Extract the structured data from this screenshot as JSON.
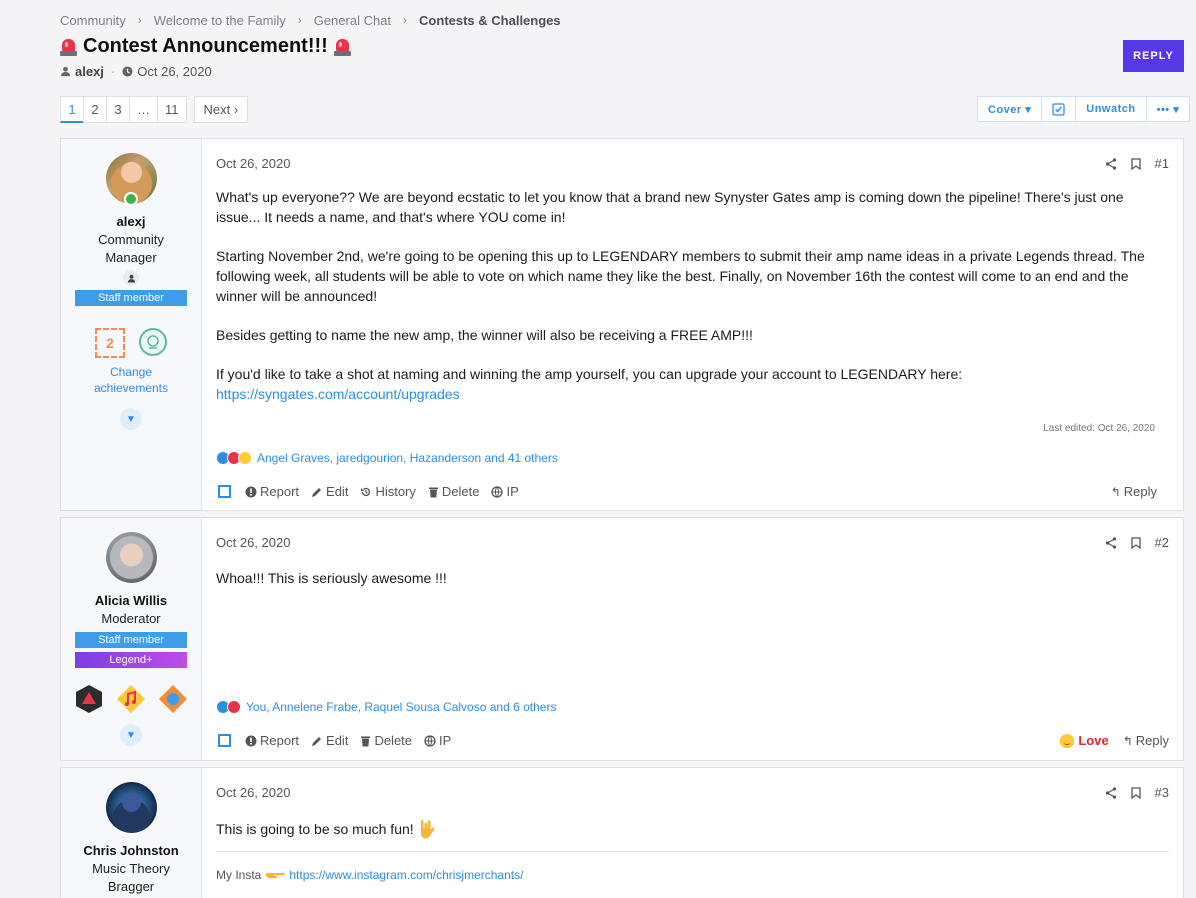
{
  "breadcrumb": [
    "Community",
    "Welcome to the Family",
    "General Chat",
    "Contests & Challenges"
  ],
  "thread": {
    "title": "Contest Announcement!!!",
    "author": "alexj",
    "date": "Oct 26, 2020",
    "reply_label": "REPLY"
  },
  "pager": {
    "pages": [
      "1",
      "2",
      "3",
      "…",
      "11"
    ],
    "next": "Next ›",
    "active": "1"
  },
  "top_actions": {
    "cover": "Cover ▾",
    "unwatch": "Unwatch",
    "more": "••• ▾"
  },
  "posts": [
    {
      "user": "alexj",
      "title": "Community Manager",
      "banners": [
        "Staff member"
      ],
      "achievement_count": "2",
      "achievements_link": "Change achievements",
      "date": "Oct 26, 2020",
      "num": "#1",
      "paragraphs": [
        "What's up everyone?? We are beyond ecstatic to let you know that a brand new Synyster Gates amp is coming down the pipeline! There's just one issue... It needs a name, and that's where YOU come in!",
        "Starting November 2nd, we're going to be opening this up to LEGENDARY members to submit their amp name ideas in a private Legends thread. The following week, all students will be able to vote on which name they like the best. Finally, on November 16th the contest will come to an end and the winner will be announced!",
        "Besides getting to name the new amp, the winner will also be receiving a FREE AMP!!!",
        "If you'd like to take a shot at naming and winning the amp yourself, you can upgrade your account to LEGENDARY here:"
      ],
      "link": "https://syngates.com/account/upgrades",
      "edited": "Last edited: Oct 26, 2020",
      "reactions": "Angel Graves, jaredgourion, Hazanderson and 41 others",
      "actions": [
        "Report",
        "Edit",
        "History",
        "Delete",
        "IP"
      ],
      "reply": "Reply"
    },
    {
      "user": "Alicia Willis",
      "title": "Moderator",
      "banners": [
        "Staff member",
        "Legend+"
      ],
      "date": "Oct 26, 2020",
      "num": "#2",
      "text": "Whoa!!! This is seriously awesome !!!",
      "reactions": "You, Annelene Frabe, Raquel Sousa Calvoso and 6 others",
      "actions": [
        "Report",
        "Edit",
        "Delete",
        "IP"
      ],
      "love": "Love",
      "reply": "Reply"
    },
    {
      "user": "Chris Johnston",
      "title": "Music Theory Bragger",
      "date": "Oct 26, 2020",
      "num": "#3",
      "text": "This is going to be so much fun!",
      "sig_label": "My Insta",
      "sig_link": "https://www.instagram.com/chrisjmerchants/"
    }
  ]
}
